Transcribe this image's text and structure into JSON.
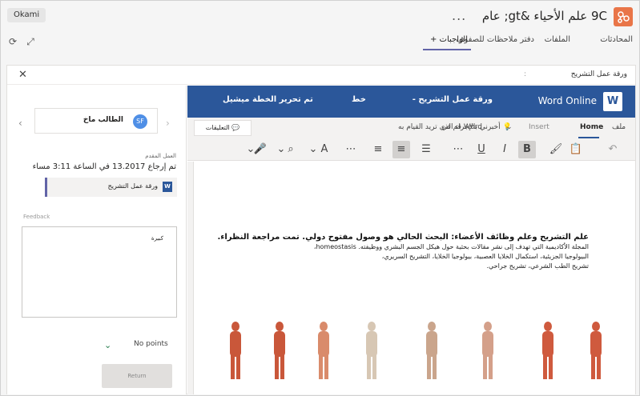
{
  "header": {
    "badge": "Okami",
    "team_title": "9C علم الأحياء &gt; عام",
    "more": "...",
    "accent": "#e97548"
  },
  "tabs": [
    {
      "label": "المحادثات"
    },
    {
      "label": "الملفات"
    },
    {
      "label": "دفتر ملاحظات للصفوف"
    },
    {
      "label": "الواجبات +"
    }
  ],
  "panel": {
    "title": "ورقة عمل التشريح",
    "mark": ":"
  },
  "left": {
    "student_name": "الطالب ماخ",
    "avatar_initials": "SF",
    "work_label": "العمل المقدم",
    "returned_text": "تم إرجاع 13.2017 في الساعة 3:11 مساء",
    "attachment": "ورقة عمل التشريح",
    "feedback_label": "Feedback",
    "feedback_text": "كبيرة",
    "points": "No points",
    "return_button": "Return"
  },
  "word": {
    "brand": "Word Online",
    "doc_title": "ورقة عمل التشريح -",
    "sep": "خط",
    "user": "تم تحرير الخطة ميشيل",
    "ribbon": {
      "file": "ملف",
      "home": "Home",
      "insert": "Insert",
      "layout": "قم في Word",
      "tellme": "أخبرني بالإجراء الذي تريد القيام به",
      "comments": "التعليقات"
    },
    "doc": {
      "heading": "علم التشريح وعلم وظائف الأعضاء: البحث الحالي هو وصول مفتوح دولي. تمت مراجعة النظراء.",
      "line1": "المجلة الأكاديمية التي تهدف إلى نشر مقالات بحثية حول هيكل الجسم البشري ووظيفته. homeostasis،",
      "line2": "البيولوجيا الجزيئية، استكمال الخلايا العصبية، بيولوجيا الخلايا، التشريح السريري،",
      "line3": "تشريح الطب الشرعي، تشريح جراحي."
    }
  }
}
